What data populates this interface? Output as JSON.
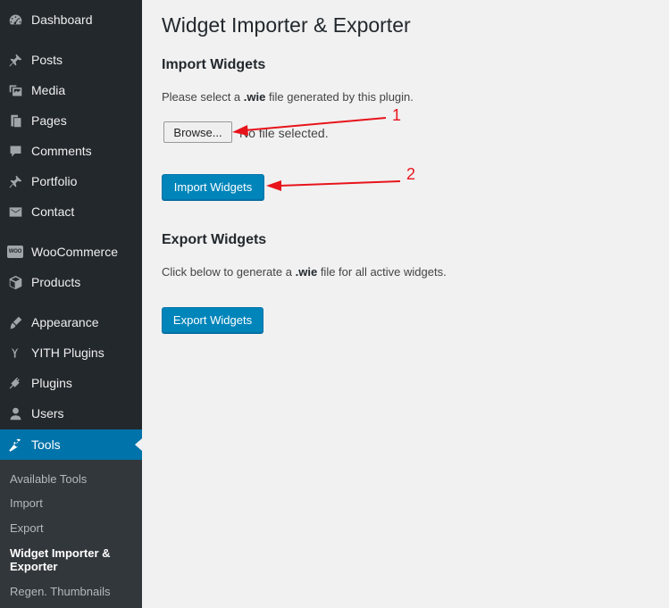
{
  "sidebar": {
    "items": [
      {
        "label": "Dashboard",
        "icon": "dashboard-icon"
      },
      {
        "label": "Posts",
        "icon": "pushpin-icon"
      },
      {
        "label": "Media",
        "icon": "media-icon"
      },
      {
        "label": "Pages",
        "icon": "pages-icon"
      },
      {
        "label": "Comments",
        "icon": "comments-icon"
      },
      {
        "label": "Portfolio",
        "icon": "pushpin-icon"
      },
      {
        "label": "Contact",
        "icon": "envelope-icon"
      },
      {
        "label": "WooCommerce",
        "icon": "woocommerce-icon",
        "badge": "WOO"
      },
      {
        "label": "Products",
        "icon": "box-icon"
      },
      {
        "label": "Appearance",
        "icon": "paintbrush-icon"
      },
      {
        "label": "YITH Plugins",
        "icon": "yith-icon"
      },
      {
        "label": "Plugins",
        "icon": "plug-icon"
      },
      {
        "label": "Users",
        "icon": "user-icon"
      },
      {
        "label": "Tools",
        "icon": "wrench-icon",
        "active": true
      }
    ],
    "submenu": [
      {
        "label": "Available Tools"
      },
      {
        "label": "Import"
      },
      {
        "label": "Export"
      },
      {
        "label": "Widget Importer & Exporter",
        "current": true
      },
      {
        "label": "Regen. Thumbnails"
      }
    ]
  },
  "main": {
    "title": "Widget Importer & Exporter",
    "import": {
      "heading": "Import Widgets",
      "desc_prefix": "Please select a",
      "desc_ext": ".wie",
      "desc_suffix": "file generated by this plugin.",
      "browse_label": "Browse...",
      "file_status": "No file selected.",
      "button_label": "Import Widgets"
    },
    "export": {
      "heading": "Export Widgets",
      "desc_prefix": "Click below to generate a",
      "desc_ext": ".wie",
      "desc_suffix": "file for all active widgets.",
      "button_label": "Export Widgets"
    }
  },
  "annotations": [
    {
      "number": "1"
    },
    {
      "number": "2"
    }
  ],
  "colors": {
    "sidebar_bg": "#23282d",
    "submenu_bg": "#32373c",
    "active_bg": "#0073aa",
    "primary_button": "#0085ba",
    "annotation_red": "#e8141b",
    "page_bg": "#f1f1f1"
  }
}
